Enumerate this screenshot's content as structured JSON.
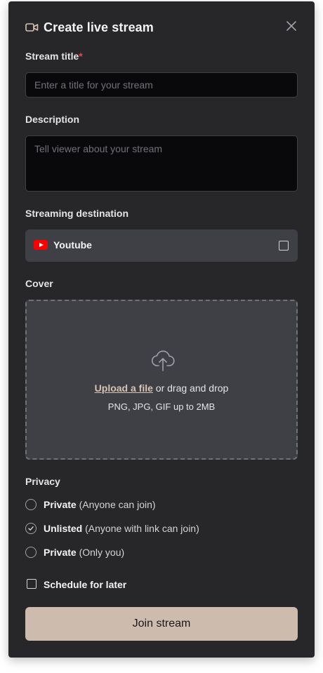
{
  "header": {
    "title": "Create live stream",
    "camera_icon": "video-camera-icon",
    "close_icon": "close-icon"
  },
  "stream_title": {
    "label": "Stream title",
    "required_mark": "*",
    "placeholder": "Enter a title for your stream",
    "value": ""
  },
  "description": {
    "label": "Description",
    "placeholder": "Tell viewer about your stream",
    "value": ""
  },
  "destination": {
    "label": "Streaming destination",
    "option": "Youtube",
    "icon": "youtube-icon",
    "checked": false
  },
  "cover": {
    "label": "Cover",
    "upload_link": "Upload a file",
    "upload_suffix": " or drag and drop",
    "hint": "PNG, JPG, GIF up to 2MB",
    "icon": "cloud-upload-icon"
  },
  "privacy": {
    "label": "Privacy",
    "options": [
      {
        "title": "Private",
        "desc": " (Anyone can join)",
        "selected": false
      },
      {
        "title": "Unlisted",
        "desc": " (Anyone with link can join)",
        "selected": true
      },
      {
        "title": "Private",
        "desc": " (Only you)",
        "selected": false
      }
    ]
  },
  "schedule": {
    "label": "Schedule for later",
    "checked": false
  },
  "submit": {
    "label": "Join stream"
  },
  "colors": {
    "panel": "#27272a",
    "accent": "#cdbcae",
    "link": "#d6c3b3",
    "required": "#ef4444",
    "youtube": "#ff0000"
  }
}
